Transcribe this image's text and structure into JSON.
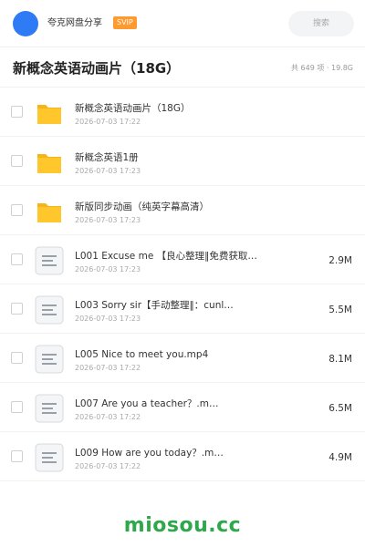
{
  "header": {
    "username": "夸克网盘分享",
    "badge": "SVIP",
    "search_placeholder": "搜索"
  },
  "title": "新概念英语动画片（18G）",
  "summary": "共 649 项 · 19.8G",
  "items": [
    {
      "type": "folder",
      "name": "新概念英语动画片（18G）",
      "date": "2026-07-03 17:22",
      "size": ""
    },
    {
      "type": "folder",
      "name": "新概念英语1册",
      "date": "2026-07-03 17:23",
      "size": ""
    },
    {
      "type": "folder",
      "name": "新版同步动画（纯英字幕高清）",
      "date": "2026-07-03 17:23",
      "size": ""
    },
    {
      "type": "file",
      "name": "L001 Excuse me 【良心整理‖免费获取…",
      "date": "2026-07-03 17:23",
      "size": "2.9M"
    },
    {
      "type": "file",
      "name": "L003 Sorry sir【手动整理‖：cunl…",
      "date": "2026-07-03 17:23",
      "size": "5.5M"
    },
    {
      "type": "file",
      "name": "L005 Nice to meet you.mp4",
      "date": "2026-07-03 17:22",
      "size": "8.1M"
    },
    {
      "type": "file",
      "name": "L007 Are you a teacher？.m…",
      "date": "2026-07-03 17:22",
      "size": "6.5M"
    },
    {
      "type": "file",
      "name": "L009 How are you today？.m…",
      "date": "2026-07-03 17:22",
      "size": "4.9M"
    }
  ],
  "watermark": "miosou.cc",
  "colors": {
    "avatar": "#2f7bf5",
    "badge": "#ff9a2e",
    "folder": "#ffc72c",
    "watermark": "#2ea84a"
  }
}
